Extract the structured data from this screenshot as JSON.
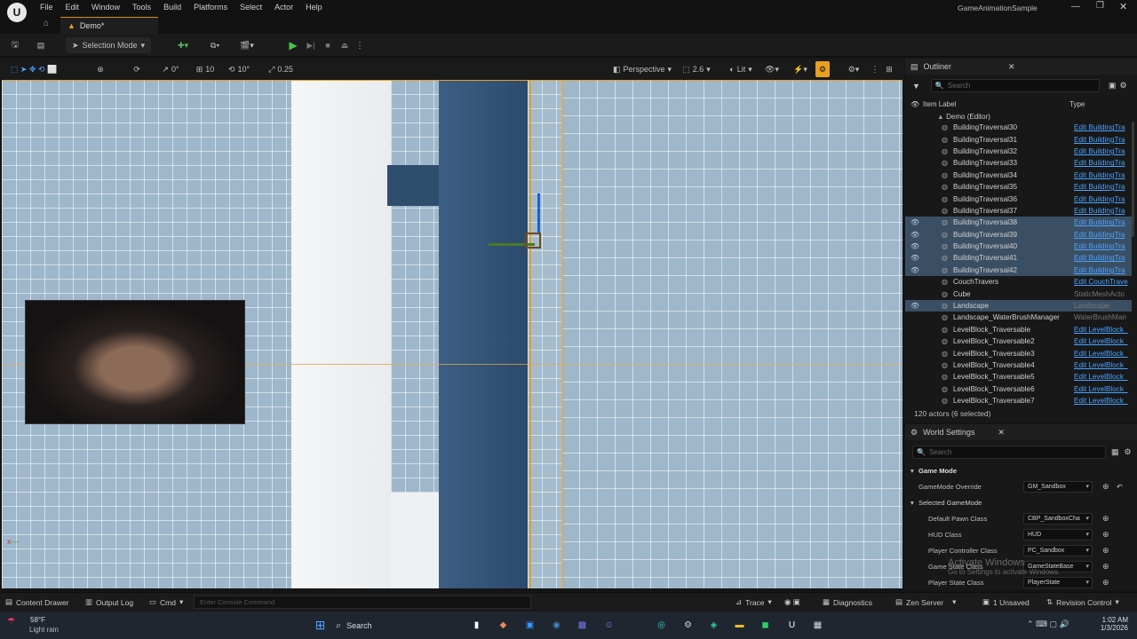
{
  "window": {
    "app_title": "GameAnimationSample",
    "tab": "Demo*"
  },
  "menu": [
    "File",
    "Edit",
    "Window",
    "Tools",
    "Build",
    "Platforms",
    "Select",
    "Actor",
    "Help"
  ],
  "toolbar": {
    "mode_label": "Selection Mode"
  },
  "viewport_toolbar": {
    "rot_snap": "0°",
    "grid_snap": "10",
    "angle_snap": "10°",
    "scale_snap": "0.25",
    "view_label": "Perspective",
    "camera_speed": "2.6",
    "lit_label": "Lit"
  },
  "outliner": {
    "title": "Outliner",
    "search_placeholder": "Search",
    "col_label": "Item Label",
    "col_type": "Type",
    "root": "Demo (Editor)",
    "rows": [
      {
        "label": "BuildingTraversal30",
        "type": "Edit BuildingTra",
        "selected": false
      },
      {
        "label": "BuildingTraversal31",
        "type": "Edit BuildingTra",
        "selected": false
      },
      {
        "label": "BuildingTraversal32",
        "type": "Edit BuildingTra",
        "selected": false
      },
      {
        "label": "BuildingTraversal33",
        "type": "Edit BuildingTra",
        "selected": false
      },
      {
        "label": "BuildingTraversal34",
        "type": "Edit BuildingTra",
        "selected": false
      },
      {
        "label": "BuildingTraversal35",
        "type": "Edit BuildingTra",
        "selected": false
      },
      {
        "label": "BuildingTraversal36",
        "type": "Edit BuildingTra",
        "selected": false
      },
      {
        "label": "BuildingTraversal37",
        "type": "Edit BuildingTra",
        "selected": false
      },
      {
        "label": "BuildingTraversal38",
        "type": "Edit BuildingTra",
        "selected": true
      },
      {
        "label": "BuildingTraversal39",
        "type": "Edit BuildingTra",
        "selected": true
      },
      {
        "label": "BuildingTraversal40",
        "type": "Edit BuildingTra",
        "selected": true
      },
      {
        "label": "BuildingTraversal41",
        "type": "Edit BuildingTra",
        "selected": true
      },
      {
        "label": "BuildingTraversal42",
        "type": "Edit BuildingTra",
        "selected": true
      },
      {
        "label": "CouchTravers",
        "type": "Edit CouchTrave",
        "selected": false
      },
      {
        "label": "Cube",
        "type": "StaticMeshActo",
        "selected": false,
        "plain": true
      },
      {
        "label": "Landscape",
        "type": "Landscape",
        "selected": true,
        "plain": true
      },
      {
        "label": "Landscape_WaterBrushManager",
        "type": "WaterBrushMan",
        "selected": false,
        "plain": true
      },
      {
        "label": "LevelBlock_Traversable",
        "type": "Edit LevelBlock_",
        "selected": false
      },
      {
        "label": "LevelBlock_Traversable2",
        "type": "Edit LevelBlock_",
        "selected": false
      },
      {
        "label": "LevelBlock_Traversable3",
        "type": "Edit LevelBlock_",
        "selected": false
      },
      {
        "label": "LevelBlock_Traversable4",
        "type": "Edit LevelBlock_",
        "selected": false
      },
      {
        "label": "LevelBlock_Traversable5",
        "type": "Edit LevelBlock_",
        "selected": false
      },
      {
        "label": "LevelBlock_Traversable6",
        "type": "Edit LevelBlock_",
        "selected": false
      },
      {
        "label": "LevelBlock_Traversable7",
        "type": "Edit LevelBlock_",
        "selected": false
      }
    ],
    "status": "120 actors (6 selected)"
  },
  "world_settings": {
    "title": "World Settings",
    "search_placeholder": "Search",
    "section_game_mode": "Game Mode",
    "game_mode_override_key": "GameMode Override",
    "game_mode_override_val": "GM_Sandbox",
    "section_selected": "Selected GameMode",
    "rows": [
      {
        "key": "Default Pawn Class",
        "val": "CBP_SandboxCha"
      },
      {
        "key": "HUD Class",
        "val": "HUD"
      },
      {
        "key": "Player Controller Class",
        "val": "PC_Sandbox"
      },
      {
        "key": "Game State Class",
        "val": "GameStateBase"
      },
      {
        "key": "Player State Class",
        "val": "PlayerState"
      }
    ],
    "watermark_1": "Activate Windows",
    "watermark_2": "Go to Settings to activate Windows."
  },
  "bottombar": {
    "content_drawer": "Content Drawer",
    "output_log": "Output Log",
    "cmd": "Cmd",
    "console_placeholder": "Enter Console Command",
    "trace": "Trace",
    "diagnostics": "Diagnostics",
    "zen": "Zen Server",
    "unsaved": "1 Unsaved",
    "revision": "Revision Control"
  },
  "taskbar": {
    "weather_temp": "58°F",
    "weather_desc": "Light rain",
    "search": "Search",
    "time": "1:02 AM",
    "date": "1/3/2026"
  }
}
